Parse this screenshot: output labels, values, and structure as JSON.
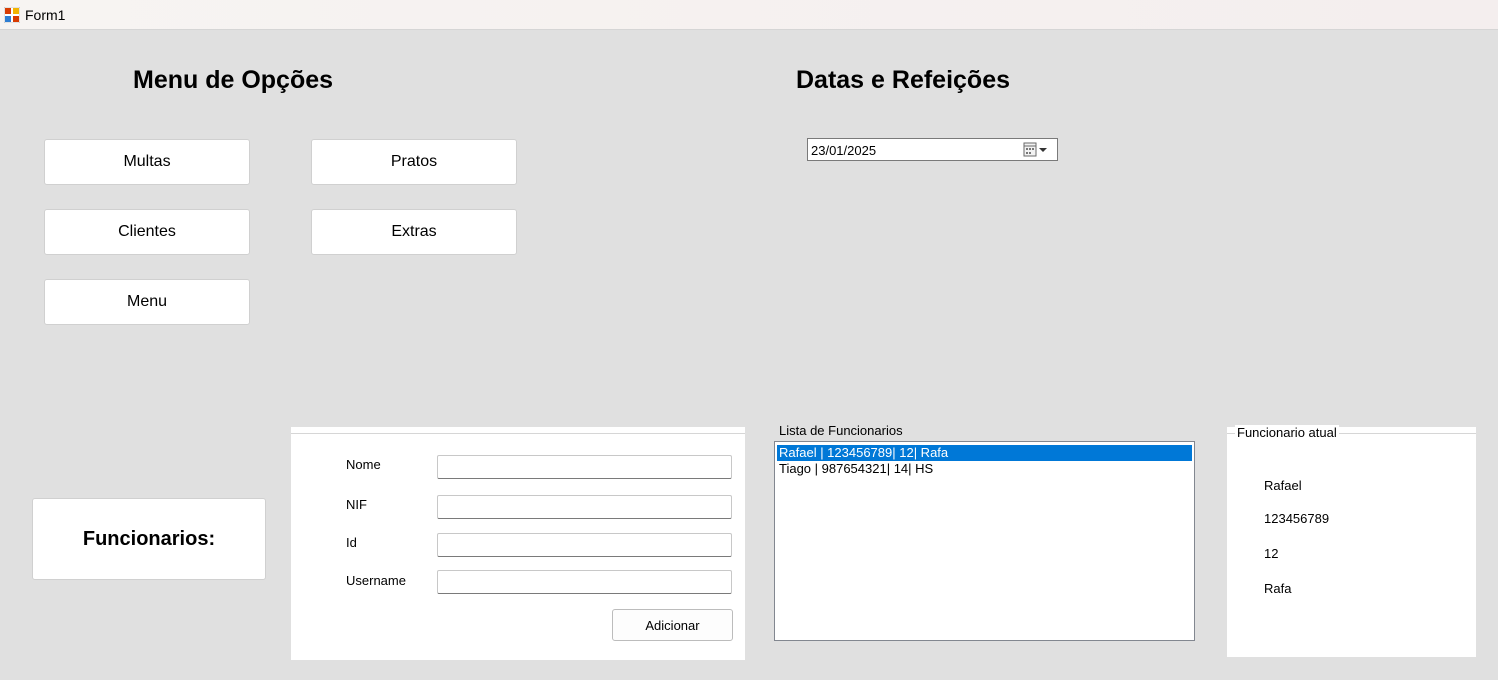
{
  "window": {
    "title": "Form1"
  },
  "menu": {
    "heading": "Menu de Opções",
    "buttons": {
      "multas": "Multas",
      "pratos": "Pratos",
      "clientes": "Clientes",
      "extras": "Extras",
      "menu": "Menu"
    }
  },
  "datas": {
    "heading": "Datas e Refeições",
    "date_value": "23/01/2025"
  },
  "funcionarios_label": "Funcionarios:",
  "form": {
    "fields": [
      {
        "label": "Nome",
        "value": ""
      },
      {
        "label": "NIF",
        "value": ""
      },
      {
        "label": "Id",
        "value": ""
      },
      {
        "label": "Username",
        "value": ""
      }
    ],
    "add_button": "Adicionar"
  },
  "list": {
    "label": "Lista de Funcionarios",
    "items": [
      "Rafael | 123456789| 12| Rafa",
      "Tiago | 987654321| 14| HS"
    ],
    "selected_index": 0
  },
  "atual": {
    "legend": "Funcionario atual",
    "nome": "Rafael",
    "nif": "123456789",
    "id": "12",
    "username": "Rafa"
  },
  "colors": {
    "background": "#e0e0e0",
    "selection": "#0078d7"
  }
}
